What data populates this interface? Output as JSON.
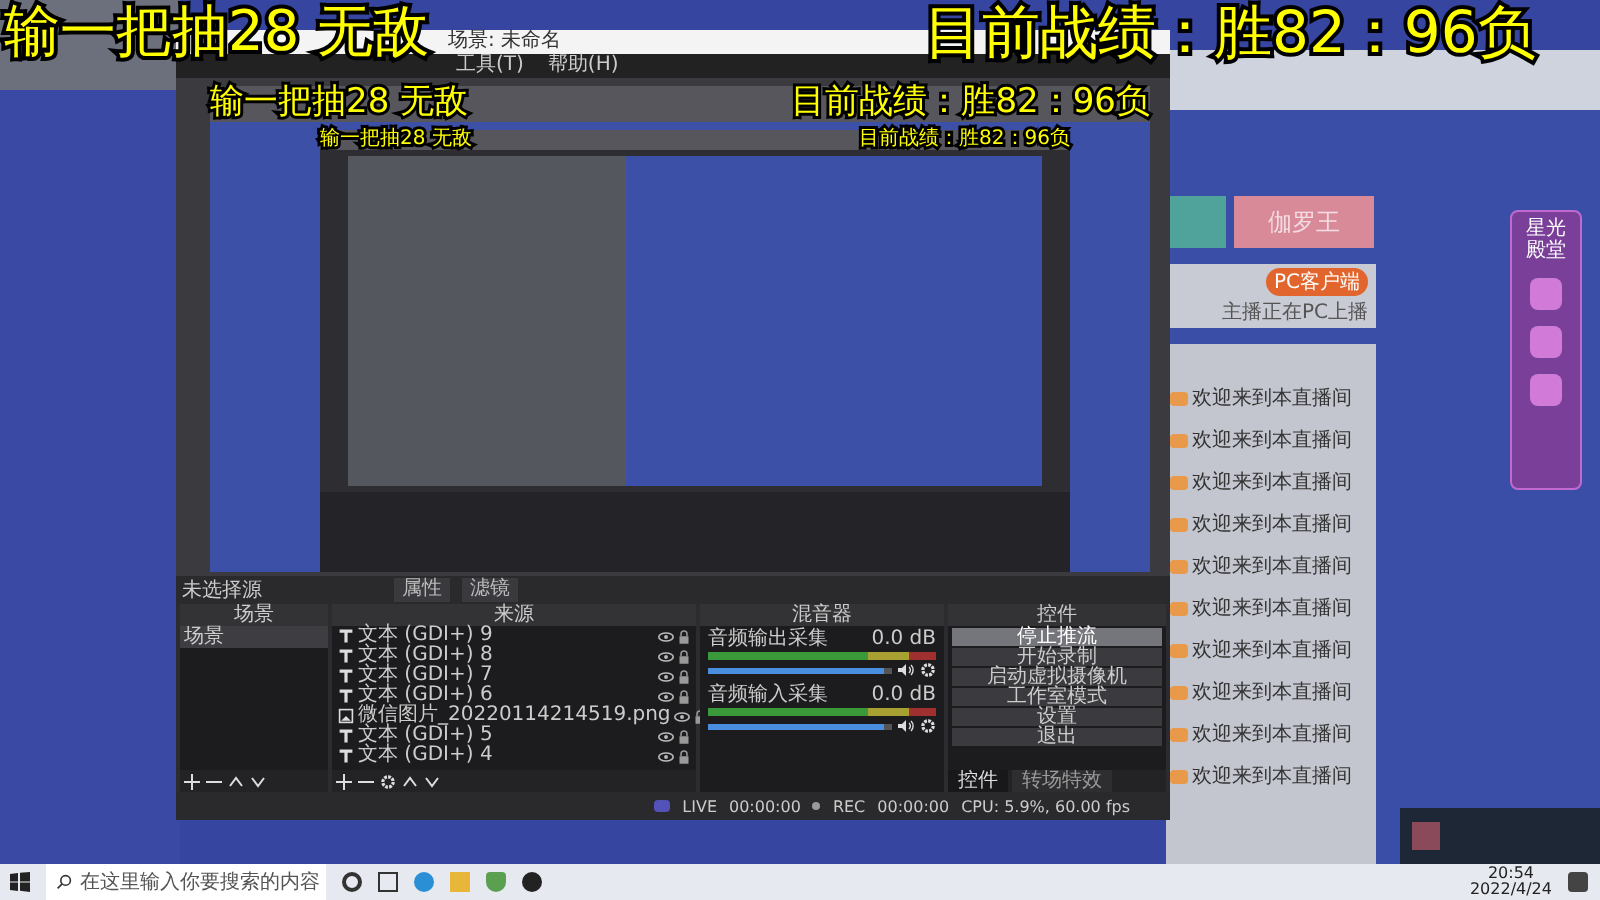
{
  "overlay": {
    "left": "输一把抽28 无敌",
    "right": "目前战绩：胜82：96负"
  },
  "obs": {
    "title": "场景: 未命名",
    "menu": [
      "工具(T)",
      "帮助(H)"
    ],
    "preview": {
      "overlay_left": "输一把抽28 无敌",
      "overlay_right": "目前战绩：胜82：96负",
      "inner_overlay_left": "输一把抽28 无敌",
      "inner_overlay_right": "目前战绩：胜82：96负"
    },
    "source_bar": {
      "label": "未选择源",
      "buttons": [
        "属性",
        "滤镜"
      ]
    },
    "scenes": {
      "title": "场景",
      "items": [
        {
          "label": "场景",
          "selected": true
        }
      ]
    },
    "sources": {
      "title": "来源",
      "items": [
        {
          "kind": "text",
          "label": "文本 (GDI+) 9"
        },
        {
          "kind": "text",
          "label": "文本 (GDI+) 8"
        },
        {
          "kind": "text",
          "label": "文本 (GDI+) 7"
        },
        {
          "kind": "text",
          "label": "文本 (GDI+) 6"
        },
        {
          "kind": "image",
          "label": "微信图片_20220114214519.png"
        },
        {
          "kind": "text",
          "label": "文本 (GDI+) 5"
        },
        {
          "kind": "text",
          "label": "文本 (GDI+) 4"
        }
      ]
    },
    "mixer": {
      "title": "混音器",
      "channels": [
        {
          "name": "音频输出采集",
          "reading": "0.0 dB",
          "level": 0.96
        },
        {
          "name": "音频输入采集",
          "reading": "0.0 dB",
          "level": 0.96
        }
      ]
    },
    "controls": {
      "title": "控件",
      "buttons": [
        {
          "label": "停止推流",
          "active": true
        },
        {
          "label": "开始录制",
          "active": false
        },
        {
          "label": "启动虚拟摄像机",
          "active": false
        },
        {
          "label": "工作室模式",
          "active": false
        },
        {
          "label": "设置",
          "active": false
        },
        {
          "label": "退出",
          "active": false
        }
      ]
    },
    "tabs": [
      {
        "label": "控件",
        "selected": true
      },
      {
        "label": "转场特效",
        "selected": false
      }
    ],
    "status": {
      "live": "LIVE",
      "live_time": "00:00:00",
      "rec": "REC",
      "rec_time": "00:00:00",
      "cpu": "CPU: 5.9%, 60.00 fps"
    }
  },
  "webpage": {
    "hero_button": "伽罗王",
    "client_badge": "PC客户端",
    "client_note": "主播正在PC上播",
    "side_title": "星光殿堂",
    "chat": [
      "欢迎来到本直播间",
      "欢迎来到本直播间",
      "欢迎来到本直播间",
      "欢迎来到本直播间",
      "欢迎来到本直播间",
      "欢迎来到本直播间",
      "欢迎来到本直播间",
      "欢迎来到本直播间",
      "欢迎来到本直播间",
      "欢迎来到本直播间"
    ]
  },
  "taskbar": {
    "search_placeholder": "在这里输入你要搜索的内容",
    "time": "20:54",
    "date": "2022/4/24"
  }
}
